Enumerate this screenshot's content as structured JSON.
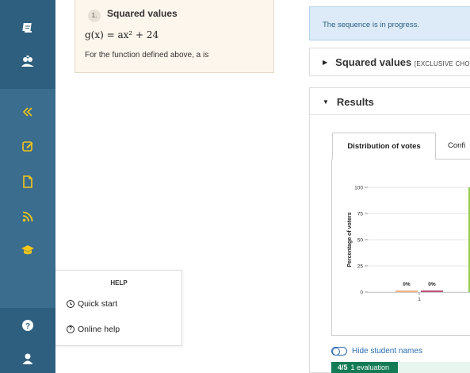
{
  "question": {
    "number": "1.",
    "title": "Squared values",
    "formula": "g(x) = ax² + 24",
    "prompt": "For the function defined above, a is"
  },
  "help": {
    "title": "HELP",
    "items": [
      {
        "label": "Quick start",
        "icon": "clock-icon"
      },
      {
        "label": "Online help",
        "icon": "question-circle-icon"
      }
    ]
  },
  "status": "The sequence is in progress.",
  "panels": {
    "squared": {
      "title": "Squared values",
      "subtitle": "[EXCLUSIVE CHO"
    },
    "results": {
      "title": "Results"
    }
  },
  "tabs": {
    "distribution": "Distribution of votes",
    "confidence": "Confi"
  },
  "chart_data": {
    "type": "bar",
    "ylabel": "Percentage of voters",
    "ylim": [
      0,
      100
    ],
    "yticks": [
      0,
      25,
      50,
      75,
      100
    ],
    "categories": [
      "1"
    ],
    "series": [
      {
        "color": "#f4b183",
        "value": 0,
        "label": "0%"
      },
      {
        "color": "#c0507a",
        "value": 0,
        "label": "0%"
      },
      {
        "color": "#92d050",
        "value": 100,
        "label": ""
      }
    ]
  },
  "hide_names": "Hide student names",
  "evaluation": {
    "progress": "4/5",
    "label": "1 evaluation",
    "fraction": 0.8
  },
  "colors": {
    "sidebar": "#3a6d8e",
    "accent_yellow": "#f5c518",
    "link": "#2b6cb0",
    "eval_green": "#137b56"
  }
}
